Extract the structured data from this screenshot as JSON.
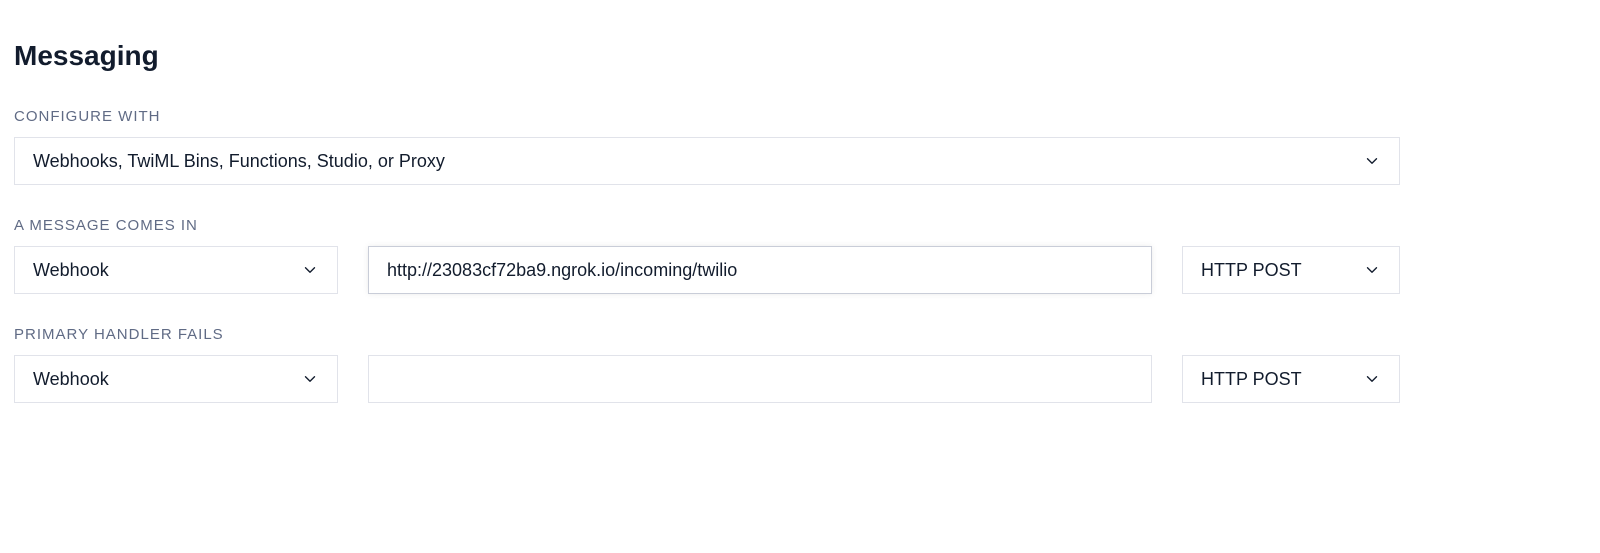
{
  "section": {
    "title": "Messaging"
  },
  "configure_with": {
    "label": "CONFIGURE WITH",
    "value": "Webhooks, TwiML Bins, Functions, Studio, or Proxy"
  },
  "message_comes_in": {
    "label": "A MESSAGE COMES IN",
    "type": "Webhook",
    "url": "http://23083cf72ba9.ngrok.io/incoming/twilio",
    "method": "HTTP POST"
  },
  "primary_handler_fails": {
    "label": "PRIMARY HANDLER FAILS",
    "type": "Webhook",
    "url": "",
    "method": "HTTP POST"
  }
}
